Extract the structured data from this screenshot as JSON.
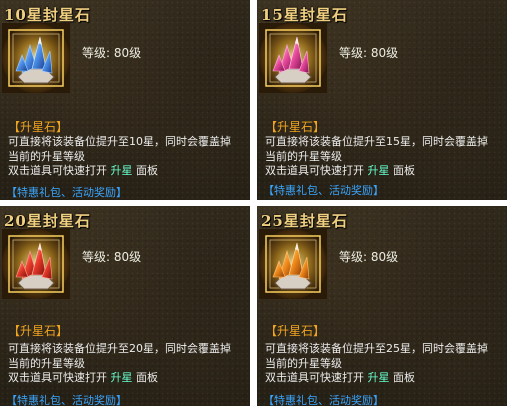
{
  "cards": [
    {
      "title": "10星封星石",
      "level": "等级: 80级",
      "tag": "【升星石】",
      "desc1": "可直接将该装备位提升至10星，同时会覆盖掉",
      "desc2": "当前的升星等级",
      "desc3_pre": "双击道具可快速打开",
      "desc3_hl": "升星",
      "desc3_post": "面板",
      "promo": "【特惠礼包、活动奖励】",
      "icon": "blue-star-crystal-icon",
      "crystal_color": "#4a8fe8"
    },
    {
      "title": "15星封星石",
      "level": "等级: 80级",
      "tag": "【升星石】",
      "desc1": "可直接将该装备位提升至15星，同时会覆盖掉",
      "desc2": "当前的升星等级",
      "desc3_pre": "双击道具可快速打开",
      "desc3_hl": "升星",
      "desc3_post": "面板",
      "promo": "【特惠礼包、活动奖励】",
      "icon": "pink-star-crystal-icon",
      "crystal_color": "#e84a9a"
    },
    {
      "title": "20星封星石",
      "level": "等级: 80级",
      "tag": "【升星石】",
      "desc1": "可直接将该装备位提升至20星，同时会覆盖掉",
      "desc2": "当前的升星等级",
      "desc3_pre": "双击道具可快速打开",
      "desc3_hl": "升星",
      "desc3_post": "面板",
      "promo": "【特惠礼包、活动奖励】",
      "icon": "red-star-crystal-icon",
      "crystal_color": "#e83a2a"
    },
    {
      "title": "25星封星石",
      "level": "等级: 80级",
      "tag": "【升星石】",
      "desc1": "可直接将该装备位提升至25星，同时会覆盖掉",
      "desc2": "当前的升星等级",
      "desc3_pre": "双击道具可快速打开",
      "desc3_hl": "升星",
      "desc3_post": "面板",
      "promo": "【特惠礼包、活动奖励】",
      "icon": "orange-star-crystal-icon",
      "crystal_color": "#f08a1a"
    }
  ]
}
